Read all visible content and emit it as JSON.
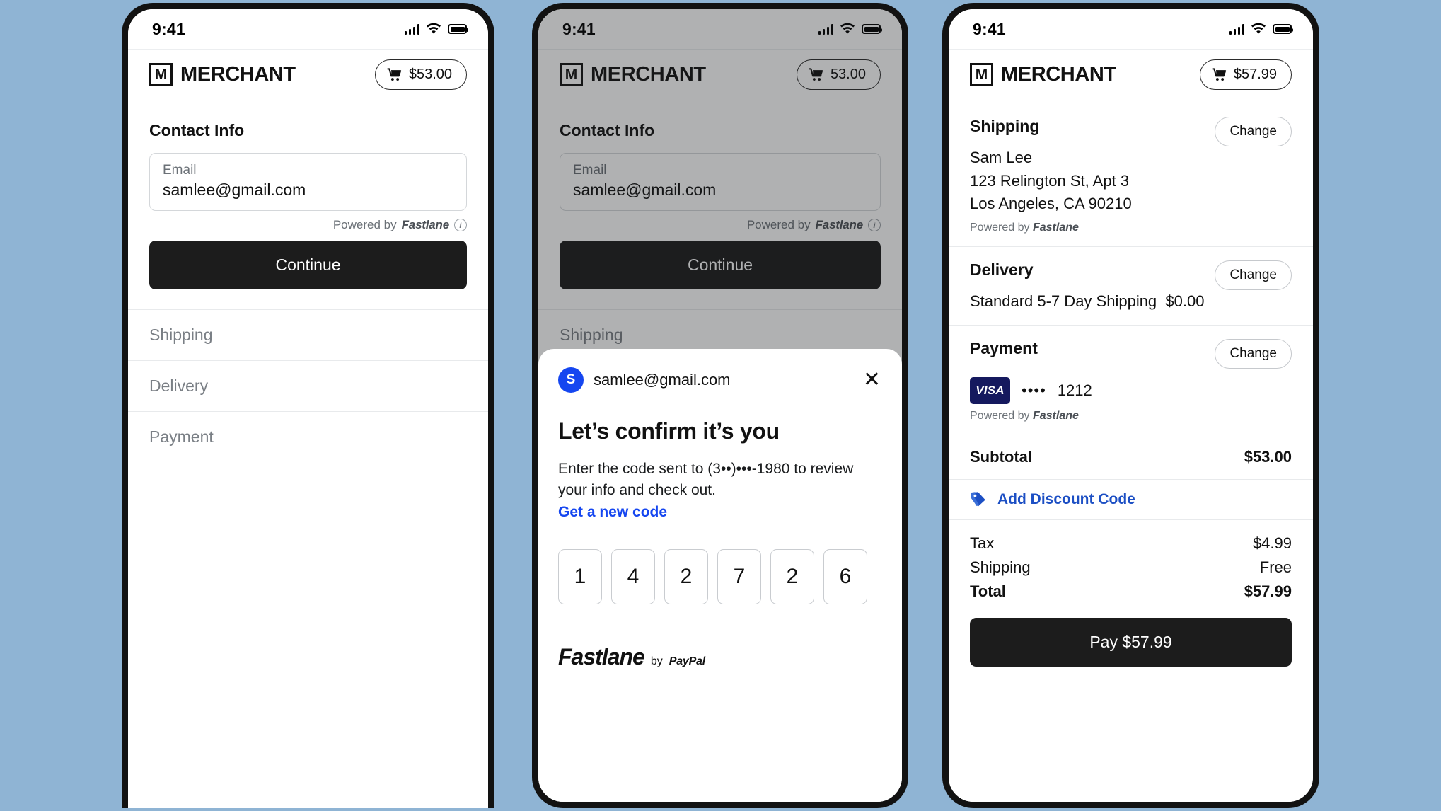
{
  "status_bar": {
    "time": "9:41",
    "icons": [
      "signal-icon",
      "wifi-icon",
      "battery-icon"
    ]
  },
  "merchant": {
    "mark": "M",
    "name": "MERCHANT"
  },
  "colors": {
    "accent_blue": "#1546f0",
    "link_blue": "#1c4fc4",
    "dark_button": "#1c1c1c",
    "visa_navy": "#15195e",
    "page_bg": "#8fb4d4"
  },
  "phone1": {
    "cart": {
      "amount": "$53.00"
    },
    "section_title": "Contact Info",
    "email": {
      "label": "Email",
      "value": "samlee@gmail.com",
      "placeholder": "Email"
    },
    "powered": {
      "prefix": "Powered by",
      "brand": "Fastlane",
      "info": "i"
    },
    "continue_label": "Continue",
    "sections": [
      "Shipping",
      "Delivery",
      "Payment"
    ]
  },
  "phone2": {
    "cart": {
      "amount": "53.00"
    },
    "section_title": "Contact Info",
    "email": {
      "label": "Email",
      "value": "samlee@gmail.com"
    },
    "powered": {
      "prefix": "Powered by",
      "brand": "Fastlane",
      "info": "i"
    },
    "continue_label": "Continue",
    "sections": [
      "Shipping",
      "Delivery",
      "Payment"
    ],
    "modal": {
      "avatar_initial": "S",
      "email": "samlee@gmail.com",
      "close": "✕",
      "heading": "Let’s confirm it’s you",
      "body": "Enter the code sent to (3••)•••-1980 to review your info and check out.",
      "link": "Get a new code",
      "otp": [
        "1",
        "4",
        "2",
        "7",
        "2",
        "6"
      ],
      "logo": {
        "main": "Fastlane",
        "by": "by",
        "brand": "PayPal"
      }
    }
  },
  "phone3": {
    "cart": {
      "amount": "$57.99"
    },
    "shipping": {
      "title": "Shipping",
      "change": "Change",
      "name": "Sam Lee",
      "address1": "123 Relington St, Apt 3",
      "address2": "Los Angeles, CA 90210",
      "powered_prefix": "Powered by",
      "powered_brand": "Fastlane"
    },
    "delivery": {
      "title": "Delivery",
      "change": "Change",
      "method": "Standard 5-7 Day Shipping",
      "price": "$0.00"
    },
    "payment": {
      "title": "Payment",
      "change": "Change",
      "brand": "VISA",
      "dots": "••••",
      "last4": "1212",
      "powered_prefix": "Powered by",
      "powered_brand": "Fastlane"
    },
    "subtotal": {
      "label": "Subtotal",
      "value": "$53.00"
    },
    "discount": {
      "label": "Add Discount Code",
      "icon": "tag-icon"
    },
    "summary": [
      {
        "label": "Tax",
        "value": "$4.99",
        "bold": false
      },
      {
        "label": "Shipping",
        "value": "Free",
        "bold": false
      },
      {
        "label": "Total",
        "value": "$57.99",
        "bold": true
      }
    ],
    "pay_button": "Pay $57.99"
  }
}
